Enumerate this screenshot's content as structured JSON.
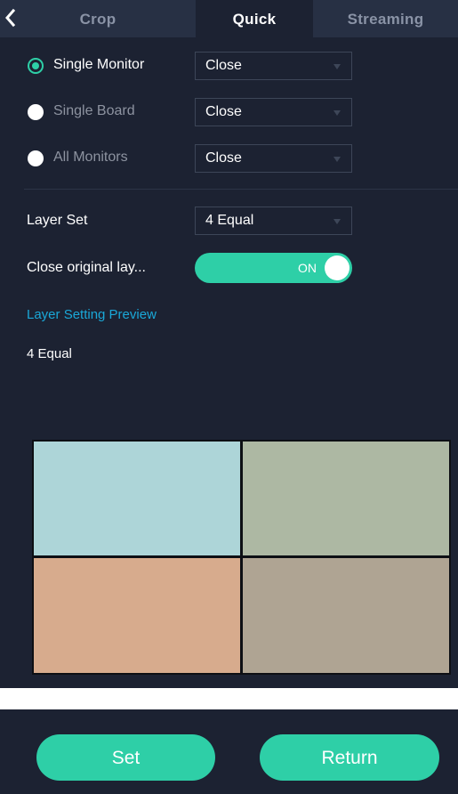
{
  "tabs": [
    {
      "label": "Crop",
      "active": false
    },
    {
      "label": "Quick",
      "active": true
    },
    {
      "label": "Streaming",
      "active": false
    }
  ],
  "target": {
    "options": [
      {
        "label": "Single Monitor",
        "selected": true,
        "value": "Close"
      },
      {
        "label": "Single Board",
        "selected": false,
        "value": "Close"
      },
      {
        "label": "All Monitors",
        "selected": false,
        "value": "Close"
      }
    ]
  },
  "layer_set": {
    "label": "Layer Set",
    "value": "4 Equal"
  },
  "close_original": {
    "label": "Close original lay...",
    "toggle_text": "ON",
    "on": true
  },
  "preview": {
    "link_label": "Layer Setting Preview",
    "layout_name": "4 Equal",
    "cells": [
      {
        "color": "#add5d8"
      },
      {
        "color": "#adb8a3"
      },
      {
        "color": "#d7ab8d"
      },
      {
        "color": "#afa493"
      }
    ]
  },
  "buttons": {
    "set": "Set",
    "return": "Return"
  },
  "colors": {
    "panel_bg": "#1c2232",
    "accent": "#2ecfa7",
    "link": "#1aa8d8"
  }
}
